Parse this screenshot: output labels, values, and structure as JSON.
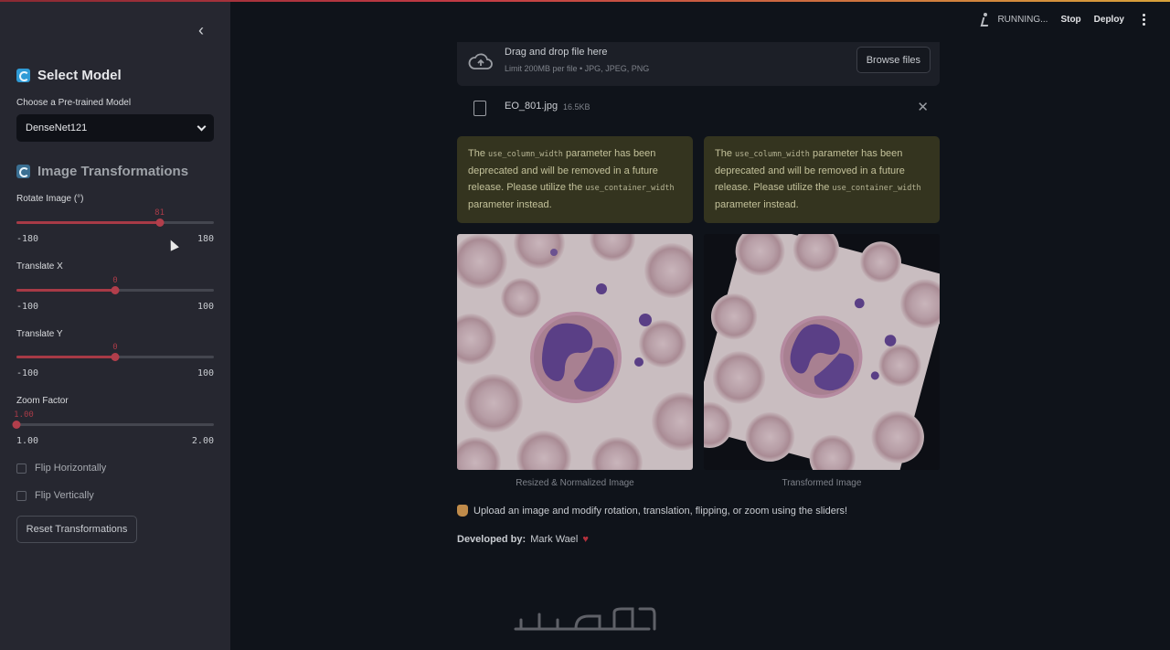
{
  "sidebar": {
    "section1_title": "Select Model",
    "model_label": "Choose a Pre-trained Model",
    "model_selected": "DenseNet121",
    "section2_title": "Image Transformations",
    "sliders": [
      {
        "label": "Rotate Image (°)",
        "value": 81,
        "value_text": "81",
        "min": -180,
        "max": 180,
        "min_text": "-180",
        "max_text": "180"
      },
      {
        "label": "Translate X",
        "value": 0,
        "value_text": "0",
        "min": -100,
        "max": 100,
        "min_text": "-100",
        "max_text": "100"
      },
      {
        "label": "Translate Y",
        "value": 0,
        "value_text": "0",
        "min": -100,
        "max": 100,
        "min_text": "-100",
        "max_text": "100"
      },
      {
        "label": "Zoom Factor",
        "value": 1.0,
        "value_text": "1.00",
        "min": 1.0,
        "max": 2.0,
        "min_text": "1.00",
        "max_text": "2.00"
      }
    ],
    "flip_h": "Flip Horizontally",
    "flip_v": "Flip Vertically",
    "reset": "Reset Transformations"
  },
  "header": {
    "status": "RUNNING...",
    "stop": "Stop",
    "deploy": "Deploy"
  },
  "uploader": {
    "title": "Drag and drop file here",
    "limits": "Limit 200MB per file • JPG, JPEG, PNG",
    "browse": "Browse files",
    "file_name": "EO_801.jpg",
    "file_size": "16.5KB"
  },
  "warnings": {
    "part1": "The ",
    "code1": "use_column_width",
    "part2": " parameter has been deprecated and will be removed in a future release. Please utilize the ",
    "code2": "use_container_width",
    "part3": " parameter instead."
  },
  "images": {
    "left_caption": "Resized & Normalized Image",
    "right_caption": "Transformed Image"
  },
  "footer": {
    "instruction": "Upload an image and modify rotation, translation, flipping, or zoom using the sliders!",
    "developed_label": "Developed by:",
    "developer": "Mark Wael"
  },
  "colors": {
    "accent": "#b23e4b",
    "sidebar_bg": "#262730",
    "main_bg": "#0f131a",
    "warning_bg": "#34341f"
  }
}
